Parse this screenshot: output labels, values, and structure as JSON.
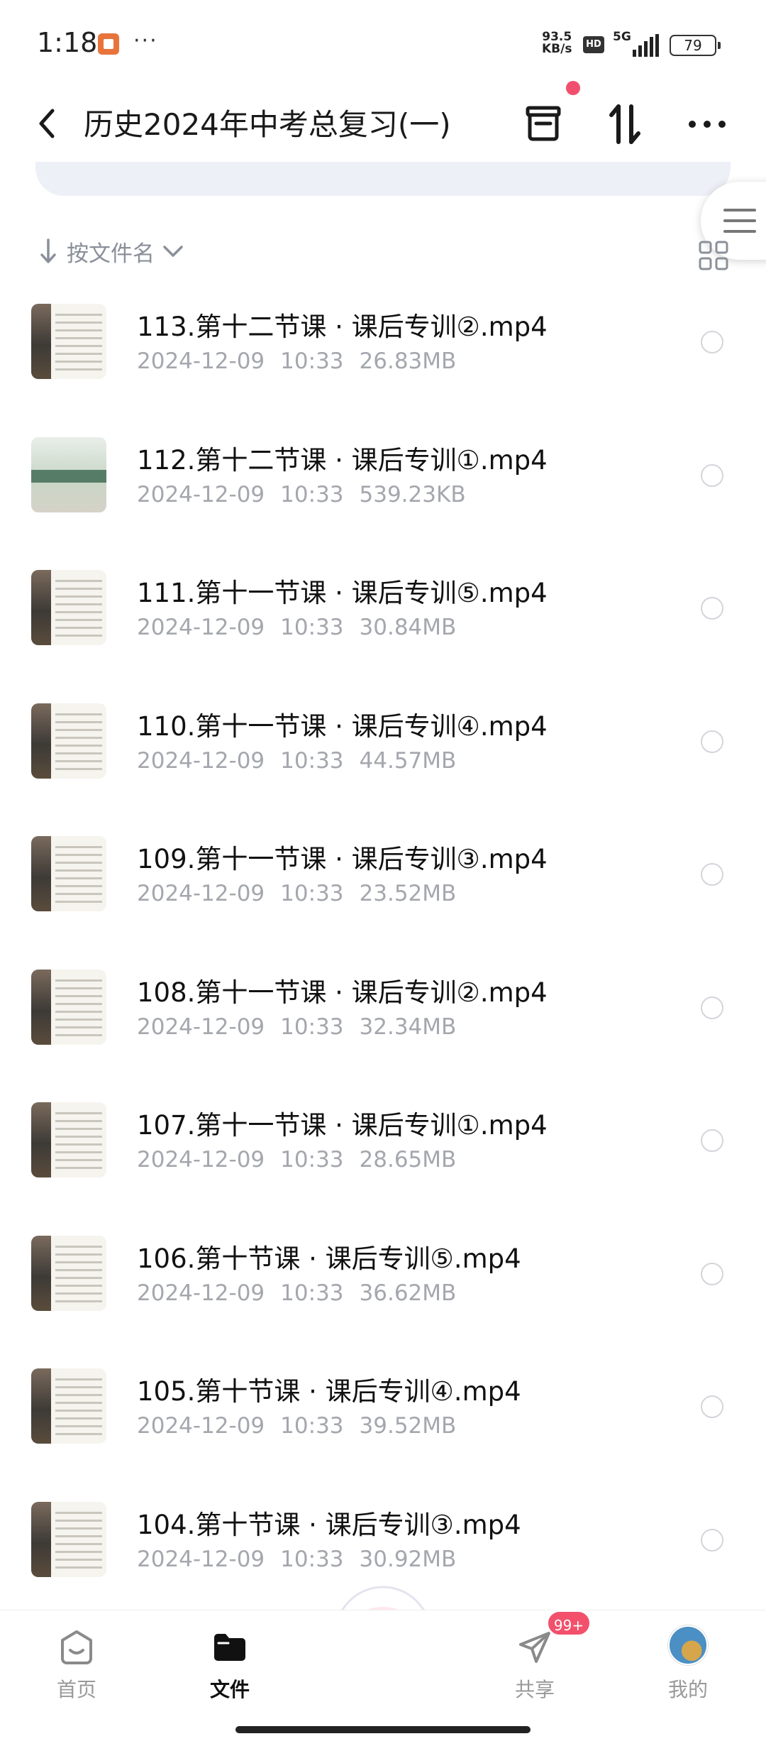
{
  "status_bar": {
    "time": "1:18",
    "speed_value": "93.5",
    "speed_unit": "KB/s",
    "hd": "HD",
    "network": "5G",
    "battery": "79"
  },
  "header": {
    "title": "历史2024年中考总复习(一)"
  },
  "sort": {
    "label": "按文件名"
  },
  "files": [
    {
      "name": "113.第十二节课 · 课后专训②.mp4",
      "date": "2024-12-09",
      "time": "10:33",
      "size": "26.83MB"
    },
    {
      "name": "112.第十二节课 · 课后专训①.mp4",
      "date": "2024-12-09",
      "time": "10:33",
      "size": "539.23KB"
    },
    {
      "name": "111.第十一节课 · 课后专训⑤.mp4",
      "date": "2024-12-09",
      "time": "10:33",
      "size": "30.84MB"
    },
    {
      "name": "110.第十一节课 · 课后专训④.mp4",
      "date": "2024-12-09",
      "time": "10:33",
      "size": "44.57MB"
    },
    {
      "name": "109.第十一节课 · 课后专训③.mp4",
      "date": "2024-12-09",
      "time": "10:33",
      "size": "23.52MB"
    },
    {
      "name": "108.第十一节课 · 课后专训②.mp4",
      "date": "2024-12-09",
      "time": "10:33",
      "size": "32.34MB"
    },
    {
      "name": "107.第十一节课 · 课后专训①.mp4",
      "date": "2024-12-09",
      "time": "10:33",
      "size": "28.65MB"
    },
    {
      "name": "106.第十节课 · 课后专训⑤.mp4",
      "date": "2024-12-09",
      "time": "10:33",
      "size": "36.62MB"
    },
    {
      "name": "105.第十节课 · 课后专训④.mp4",
      "date": "2024-12-09",
      "time": "10:33",
      "size": "39.52MB"
    },
    {
      "name": "104.第十节课 · 课后专训③.mp4",
      "date": "2024-12-09",
      "time": "10:33",
      "size": "30.92MB"
    }
  ],
  "nav": {
    "home": "首页",
    "files": "文件",
    "share": "共享",
    "mine": "我的",
    "share_badge": "99+"
  },
  "icons": {
    "back": "back-chevron-icon",
    "archive": "archive-box-icon",
    "sort_toggle": "sort-arrows-icon",
    "more": "more-dots-icon",
    "grid": "grid-view-icon",
    "menu": "hamburger-menu-icon"
  },
  "colors": {
    "accent_red": "#f0506e",
    "meta_gray": "#a4a7ad",
    "banner": "#eef0f7"
  }
}
